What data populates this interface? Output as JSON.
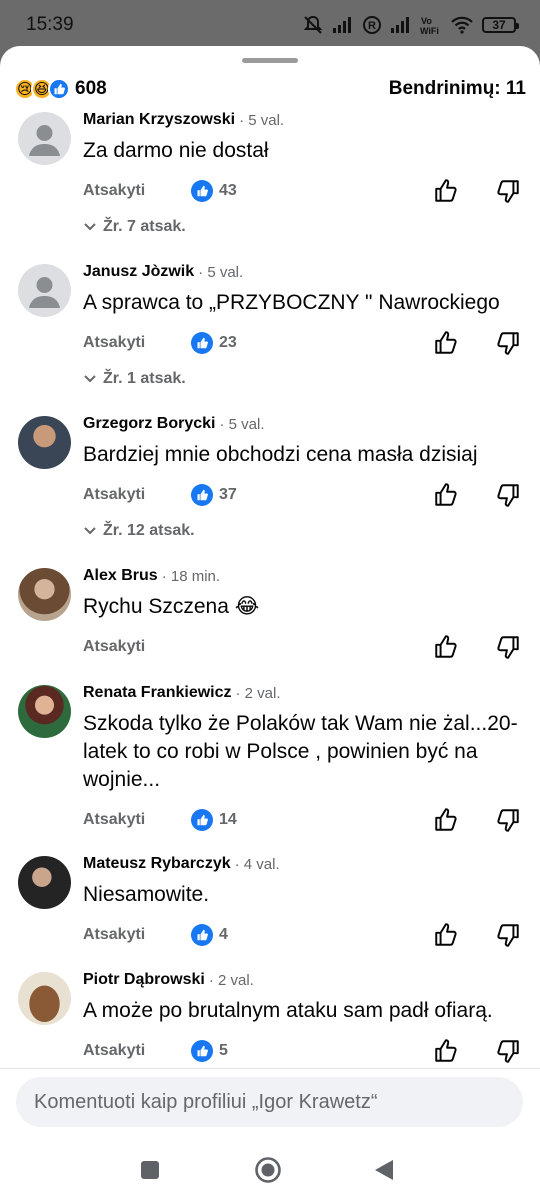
{
  "status_bar": {
    "time": "15:39",
    "battery": "37"
  },
  "summary": {
    "reaction_count": "608",
    "shares": "Bendrinimų: 11",
    "reaction_icons": [
      "sad-emoji-icon",
      "haha-emoji-icon",
      "like-icon"
    ]
  },
  "comments": [
    {
      "author": "Marian Krzyszowski",
      "time": "· 5 val.",
      "text": "Za darmo nie dostał",
      "reply": "Atsakyti",
      "likes": "43",
      "replies": "Žr. 7 atsak."
    },
    {
      "author": "Janusz Jòzwik",
      "time": "· 5 val.",
      "text": "A sprawca to „PRZYBOCZNY \" Nawrockiego",
      "reply": "Atsakyti",
      "likes": "23",
      "replies": "Žr. 1 atsak."
    },
    {
      "author": "Grzegorz Borycki",
      "time": "· 5 val.",
      "text": "Bardziej mnie obchodzi cena masła dzisiaj",
      "reply": "Atsakyti",
      "likes": "37",
      "replies": "Žr. 12 atsak."
    },
    {
      "author": "Alex Brus",
      "time": "· 18 min.",
      "text": "Rychu Szczena",
      "emoji": "😂",
      "reply": "Atsakyti"
    },
    {
      "author": "Renata Frankiewicz",
      "time": "· 2 val.",
      "text": "Szkoda tylko że Polaków tak Wam nie żal...20- latek to co robi w Polsce , powinien być na wojnie...",
      "reply": "Atsakyti",
      "likes": "14"
    },
    {
      "author": "Mateusz Rybarczyk",
      "time": "· 4 val.",
      "text": "Niesamowite.",
      "reply": "Atsakyti",
      "likes": "4"
    },
    {
      "author": "Piotr Dąbrowski",
      "time": "· 2 val.",
      "text": "A może po brutalnym ataku sam padł ofiarą.",
      "reply": "Atsakyti",
      "likes": "5"
    }
  ],
  "composer": {
    "placeholder": "Komentuoti kaip profiliui „Igor Krawetz“"
  },
  "colors": {
    "accent": "#1877f2",
    "secondary_text": "#65676b"
  }
}
